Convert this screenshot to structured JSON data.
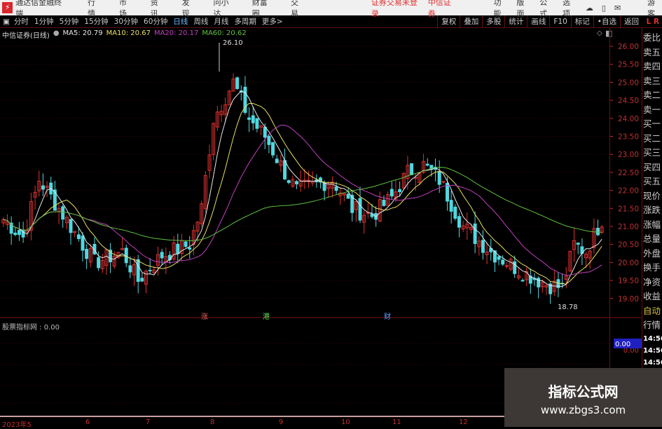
{
  "titlebar": {
    "app": "通达信金融终端",
    "menus": [
      "行情",
      "市场",
      "资讯",
      "发现",
      "问小达",
      "财富圈",
      "交易"
    ],
    "trade_status": "证券交易未登录",
    "broker": "中信证券",
    "tools": [
      "功能",
      "版面",
      "公式",
      "选项"
    ],
    "user": "游客"
  },
  "toolbar": {
    "periods": [
      "分时",
      "1分钟",
      "5分钟",
      "15分钟",
      "30分钟",
      "60分钟",
      "日线",
      "周线",
      "月线",
      "多周期",
      "更多>"
    ],
    "active": "日线",
    "right": [
      "复权",
      "叠加",
      "多股",
      "统计",
      "画线",
      "F10",
      "标记",
      "•自选",
      "返回"
    ]
  },
  "legend": {
    "stock": "中信证券(日线)",
    "ma5": "MA5: 20.79",
    "ma10": "MA10: 20.67",
    "ma20": "MA20: 20.17",
    "ma60": "MA60: 20.62"
  },
  "colors": {
    "up": "#e03030",
    "down": "#4fd8e0",
    "ma5": "#e8e8e8",
    "ma10": "#e8e060",
    "ma20": "#c040c0",
    "ma60": "#60c040",
    "axis": "#c03030"
  },
  "chart_data": {
    "type": "candlestick",
    "ylim": [
      18.8,
      26.2
    ],
    "yticks": [
      "26.00",
      "25.50",
      "25.00",
      "24.50",
      "24.00",
      "23.50",
      "23.00",
      "22.50",
      "22.00",
      "21.50",
      "21.00",
      "20.50",
      "20.00",
      "19.50",
      "19.00"
    ],
    "close_keypoints": [
      [
        0,
        21.2
      ],
      [
        5,
        20.7
      ],
      [
        9,
        22.3
      ],
      [
        14,
        21.5
      ],
      [
        23,
        20.0
      ],
      [
        30,
        20.3
      ],
      [
        34,
        19.5
      ],
      [
        40,
        20.2
      ],
      [
        47,
        20.5
      ],
      [
        50,
        21.5
      ],
      [
        53,
        24.0
      ],
      [
        58,
        25.0
      ],
      [
        62,
        24.0
      ],
      [
        66,
        23.5
      ],
      [
        71,
        22.5
      ],
      [
        74,
        22.0
      ],
      [
        83,
        22.3
      ],
      [
        88,
        21.5
      ],
      [
        93,
        21.3
      ],
      [
        98,
        21.8
      ],
      [
        102,
        22.5
      ],
      [
        106,
        22.7
      ],
      [
        110,
        22.3
      ],
      [
        116,
        21.0
      ],
      [
        123,
        20.3
      ],
      [
        130,
        19.8
      ],
      [
        137,
        19.4
      ],
      [
        141,
        19.3
      ],
      [
        144,
        20.5
      ],
      [
        147,
        20.3
      ],
      [
        151,
        21.2
      ]
    ],
    "high_label": "26.10",
    "low_label": "18.78",
    "xticks": [
      "2023年5",
      "6",
      "7",
      "8",
      "9",
      "10",
      "11",
      "12"
    ]
  },
  "events": [
    "涨",
    "港",
    "财"
  ],
  "right_panel": [
    "委比",
    "卖五",
    "卖四",
    "卖三",
    "卖二",
    "卖一",
    "买一",
    "买二",
    "买三",
    "买四",
    "买五",
    "现价",
    "涨跌",
    "涨幅",
    "总量",
    "外盘",
    "换手",
    "净资",
    "收益"
  ],
  "right_panel_extra": [
    "自动",
    "行情"
  ],
  "ticks_time": [
    "14:56",
    "14:56",
    "14:56",
    "14:56",
    "14:56",
    "14:56",
    "14:56",
    "14:56"
  ],
  "sub": {
    "title": "股票指标网 : 0.00",
    "labels": [
      "0.00",
      "0.00",
      "0.00"
    ],
    "current": "0.00"
  },
  "watermark": {
    "name": "指标公式网",
    "url": "www.zbgs3.com"
  }
}
